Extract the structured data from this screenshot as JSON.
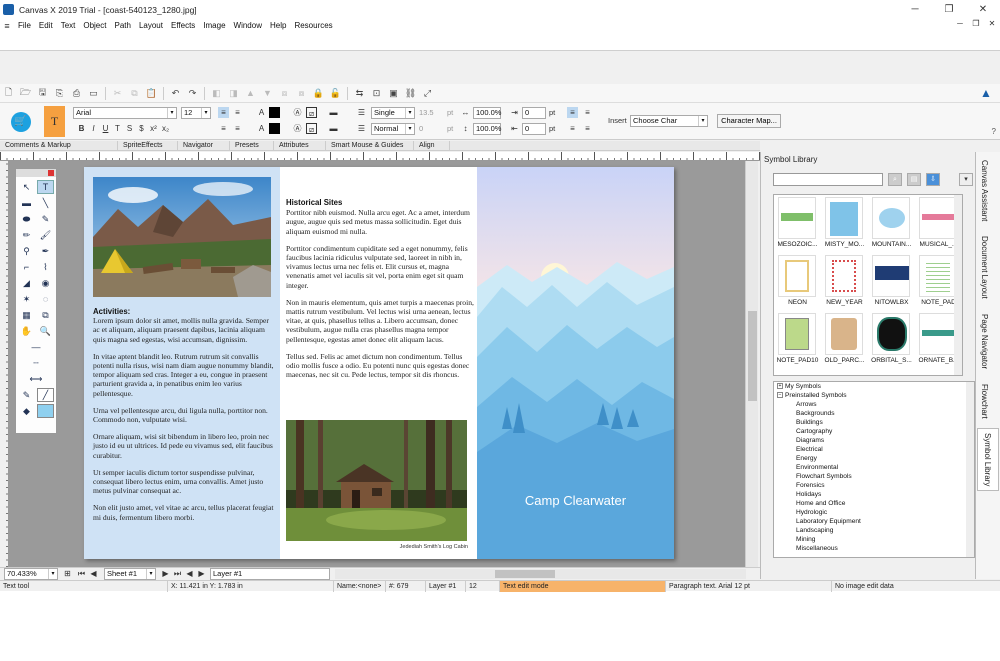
{
  "window": {
    "title": "Canvas X 2019 Trial - [coast-540123_1280.jpg]"
  },
  "menu": [
    "File",
    "Edit",
    "Text",
    "Object",
    "Path",
    "Layout",
    "Effects",
    "Image",
    "Window",
    "Help",
    "Resources"
  ],
  "format_bar": {
    "font": "Arial",
    "size": "12",
    "spacing": "Single",
    "spacing_val": "13.5",
    "style": "Normal",
    "style_val": "0",
    "pct1": "100.0%",
    "pct2": "100.0%",
    "val_a": "0",
    "val_b": "0",
    "unit": "pt",
    "insert_label": "Insert",
    "insert_value": "Choose Char",
    "char_map": "Character Map..."
  },
  "tabs": [
    "Comments & Markup",
    "SpriteEffects",
    "Navigator",
    "Presets",
    "Attributes",
    "Smart Mouse & Guides",
    "Align"
  ],
  "document": {
    "left": {
      "heading": "Activities:",
      "paras": [
        "Lorem ipsum dolor sit amet, mollis nulla gravida. Semper ac et aliquam, aliquam praesent dapibus, lacinia aliquam quis magna sed egestas, wisi accumsan, dignissim.",
        "In vitae aptent blandit leo. Rutrum rutrum sit convallis potenti nulla risus, wisi nam diam augue nonummy blandit, tempor aliquam sed cras. Integer a eu, congue in praesent parturient gravida a, in penatibus enim leo varius pellentesque.",
        "Urna vel pellentesque arcu, dui ligula nulla, porttitor non. Commodo non, vulputate wisi.",
        "Ornare aliquam, wisi sit bibendum in libero leo, proin nec justo id eu ut ultrices. Id pede eu vivamus sed, elit faucibus curabitur.",
        "Ut semper iaculis dictum tortor suspendisse pulvinar, consequat libero lectus enim, urna convallis. Amet justo metus pulvinar consequat ac.",
        "Non elit justo amet, vel vitae ac arcu, tellus placerat feugiat mi duis, fermentum libero morbi."
      ]
    },
    "mid": {
      "heading": "Historical Sites",
      "paras": [
        "Porttitor nibh euismod. Nulla arcu eget. Ac a amet, interdum augue, augue quis sed metus massa sollicitudin. Eget duis aliquam euismod mi nulla.",
        "Porttitor condimentum cupiditate sed a eget nonummy, felis faucibus lacinia ridiculus vulputate sed, laoreet in nibh in, vivamus lectus urna nec felis et. Elit cursus et, magna venenatis amet vel iaculis sit vel, porta enim eget sit quam integer.",
        "Non in mauris elementum, quis amet turpis a maecenas proin, mattis rutrum vestibulum. Vel lectus wisi urna aenean, lectus vitae, at quis, phasellus tellus a. Libero accumsan, donec vestibulum, augue nulla cras phasellus magna tempor pellentesque, egestas amet donec elit aliquam lacus.",
        "Tellus sed. Felis ac amet dictum non condimentum. Tellus odio mollis fusce a odio. Eu potenti nunc quis egestas donec maecenas, nec sit cu. Pede lectus, tempor sit dis rhoncus."
      ],
      "caption": "Jedediah Smith's Log Cabin"
    },
    "right": {
      "title": "Camp Clearwater"
    }
  },
  "scrollbar": {
    "zoom": "70.433%",
    "sheet": "Sheet #1",
    "layer": "Layer #1"
  },
  "status": {
    "tool": "Text tool",
    "coords": "X: 11.421 in Y: 1.783 in",
    "name": "Name:<none>",
    "count": "#: 679",
    "layer": "Layer #1",
    "objects": "12",
    "mode": "Text edit mode",
    "para": "Paragraph text. Arial 12 pt",
    "image": "No image edit data"
  },
  "symbol_library": {
    "title": "Symbol Library",
    "items": [
      {
        "label": "MESOZOIC...",
        "color": "#7fbf6a"
      },
      {
        "label": "MISTY_MO...",
        "color": "#7fc3e8"
      },
      {
        "label": "MOUNTAIN...",
        "color": "#9fd2ee"
      },
      {
        "label": "MUSICAL_...",
        "color": "#e57a9a"
      },
      {
        "label": "NEON",
        "color": "#e8c97a"
      },
      {
        "label": "NEW_YEAR",
        "color": "#d84c4c"
      },
      {
        "label": "NITOWLBX",
        "color": "#1f3c74"
      },
      {
        "label": "NOTE_PAD",
        "color": "#9fcf8f"
      },
      {
        "label": "NOTE_PAD10",
        "color": "#bcd98a"
      },
      {
        "label": "OLD_PARC...",
        "color": "#d9b48a"
      },
      {
        "label": "ORBITAL_S...",
        "color": "#2a7a6a"
      },
      {
        "label": "ORNATE_B...",
        "color": "#3a9a8a"
      }
    ],
    "tree": [
      "My Symbols",
      "Preinstalled Symbols",
      "Arrows",
      "Backgrounds",
      "Buildings",
      "Cartography",
      "Diagrams",
      "Electrical",
      "Energy",
      "Environmental",
      "Flowchart Symbols",
      "Forensics",
      "Holidays",
      "Home and Office",
      "Hydrologic",
      "Laboratory Equipment",
      "Landscaping",
      "Mining",
      "Miscellaneous"
    ]
  },
  "side_tabs": [
    "Canvas Assistant",
    "Document Layout",
    "Page Navigator",
    "Flowchart",
    "Symbol Library"
  ]
}
